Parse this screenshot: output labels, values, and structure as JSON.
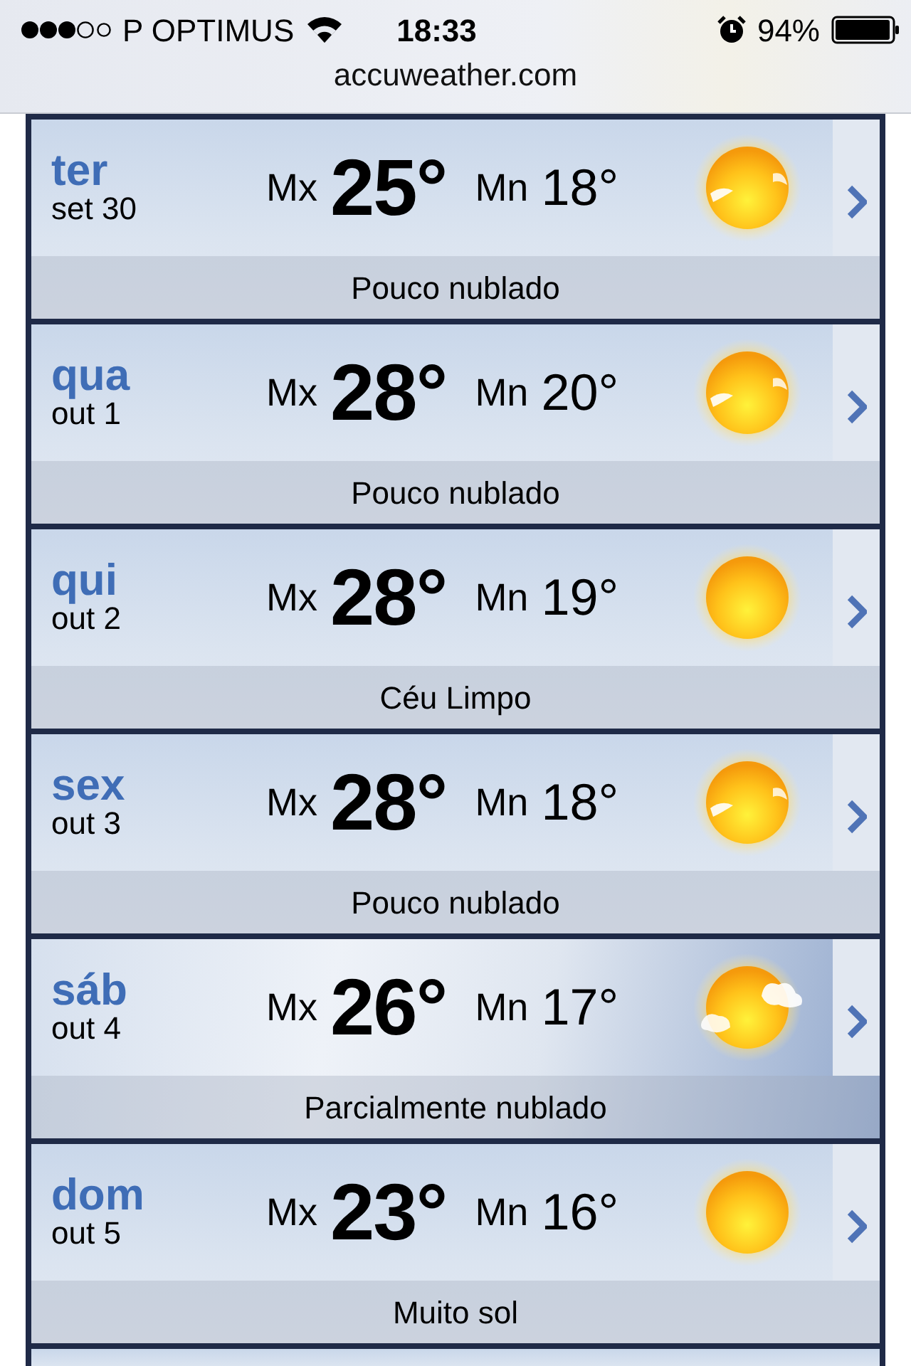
{
  "status_bar": {
    "carrier": "P OPTIMUS",
    "time": "18:33",
    "battery": "94%"
  },
  "url": "accuweather.com",
  "days": [
    {
      "day": "ter",
      "date": "set 30",
      "max_label": "Mx",
      "max": "25°",
      "min_label": "Mn",
      "min": "18°",
      "condition": "Pouco nublado",
      "kind": "sun-wisp"
    },
    {
      "day": "qua",
      "date": "out 1",
      "max_label": "Mx",
      "max": "28°",
      "min_label": "Mn",
      "min": "20°",
      "condition": "Pouco nublado",
      "kind": "sun-wisp"
    },
    {
      "day": "qui",
      "date": "out 2",
      "max_label": "Mx",
      "max": "28°",
      "min_label": "Mn",
      "min": "19°",
      "condition": "Céu Limpo",
      "kind": "sun"
    },
    {
      "day": "sex",
      "date": "out 3",
      "max_label": "Mx",
      "max": "28°",
      "min_label": "Mn",
      "min": "18°",
      "condition": "Pouco nublado",
      "kind": "sun-wisp"
    },
    {
      "day": "sáb",
      "date": "out 4",
      "max_label": "Mx",
      "max": "26°",
      "min_label": "Mn",
      "min": "17°",
      "condition": "Parcialmente nublado",
      "kind": "sun-cloud"
    },
    {
      "day": "dom",
      "date": "out 5",
      "max_label": "Mx",
      "max": "23°",
      "min_label": "Mn",
      "min": "16°",
      "condition": "Muito sol",
      "kind": "sun"
    }
  ]
}
